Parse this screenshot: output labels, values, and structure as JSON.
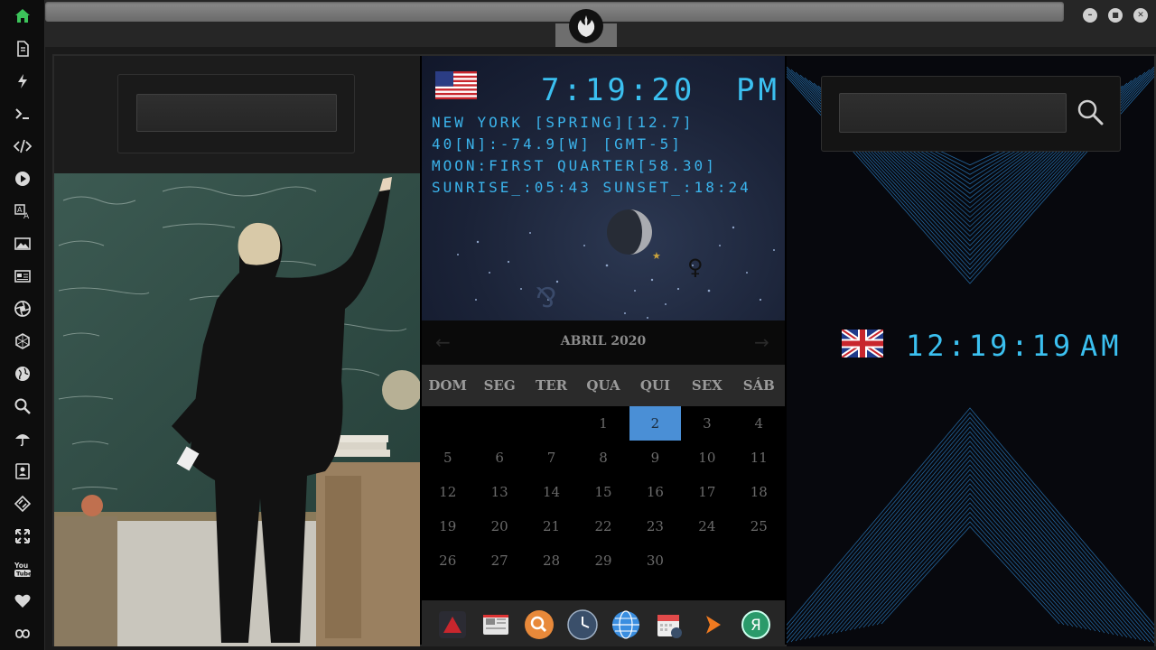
{
  "sidebar": {
    "items": [
      {
        "name": "home-icon",
        "color": "#3cc35a"
      },
      {
        "name": "document-icon"
      },
      {
        "name": "lightning-icon"
      },
      {
        "name": "terminal-icon"
      },
      {
        "name": "code-icon"
      },
      {
        "name": "play-icon"
      },
      {
        "name": "translate-icon"
      },
      {
        "name": "image-icon"
      },
      {
        "name": "news-icon"
      },
      {
        "name": "aperture-icon"
      },
      {
        "name": "hexagon-icon"
      },
      {
        "name": "globe-icon"
      },
      {
        "name": "search-icon"
      },
      {
        "name": "umbrella-icon"
      },
      {
        "name": "contact-card-icon"
      },
      {
        "name": "link-diamond-icon"
      },
      {
        "name": "expand-icon"
      },
      {
        "name": "youtube-icon",
        "label": "You Tube"
      },
      {
        "name": "heart-icon"
      },
      {
        "name": "infinity-cloud-icon"
      }
    ]
  },
  "window": {
    "buttons": {
      "minimize": "–",
      "maximize": "■",
      "close": "✕"
    }
  },
  "left_panel": {
    "search": {
      "value": "",
      "placeholder": ""
    }
  },
  "new_york": {
    "flag": "us-flag",
    "time": "7:19:20",
    "ampm": "PM",
    "line1": "NEW YORK [SPRING][12.7]",
    "line2": "40[N]:-74.9[W] [GMT-5]",
    "line3": "MOON:FIRST QUARTER[58.30]",
    "line4": "SUNRISE_:05:43 SUNSET_:18:24"
  },
  "calendar": {
    "title": "ABRIL 2020",
    "prev": "←",
    "next": "→",
    "weekdays": [
      "DOM",
      "SEG",
      "TER",
      "QUA",
      "QUI",
      "SEX",
      "SÁB"
    ],
    "leading_blanks": 3,
    "days": [
      "1",
      "2",
      "3",
      "4",
      "5",
      "6",
      "7",
      "8",
      "9",
      "10",
      "11",
      "12",
      "13",
      "14",
      "15",
      "16",
      "17",
      "18",
      "19",
      "20",
      "21",
      "22",
      "23",
      "24",
      "25",
      "26",
      "27",
      "28",
      "29",
      "30"
    ],
    "today": "2",
    "today_color": "#4a8fd6"
  },
  "dock": {
    "items": [
      {
        "name": "red-triangle-app-icon",
        "color": "#c8262d"
      },
      {
        "name": "news-app-icon",
        "color": "#e5e5e5"
      },
      {
        "name": "magnifier-app-icon",
        "color": "#e8893a"
      },
      {
        "name": "clock-app-icon",
        "color": "#3a4f6a"
      },
      {
        "name": "globe-app-icon",
        "color": "#3a8ee0"
      },
      {
        "name": "calendar-app-icon",
        "color": "#e24a4a"
      },
      {
        "name": "arrow-app-icon",
        "color": "#f07a20"
      },
      {
        "name": "yandex-app-icon",
        "color": "#2a9a6a",
        "label": "Я"
      }
    ]
  },
  "right_panel": {
    "search": {
      "value": "",
      "placeholder": ""
    }
  },
  "london": {
    "flag": "uk-flag",
    "time": "12:19:19",
    "ampm": "AM"
  }
}
